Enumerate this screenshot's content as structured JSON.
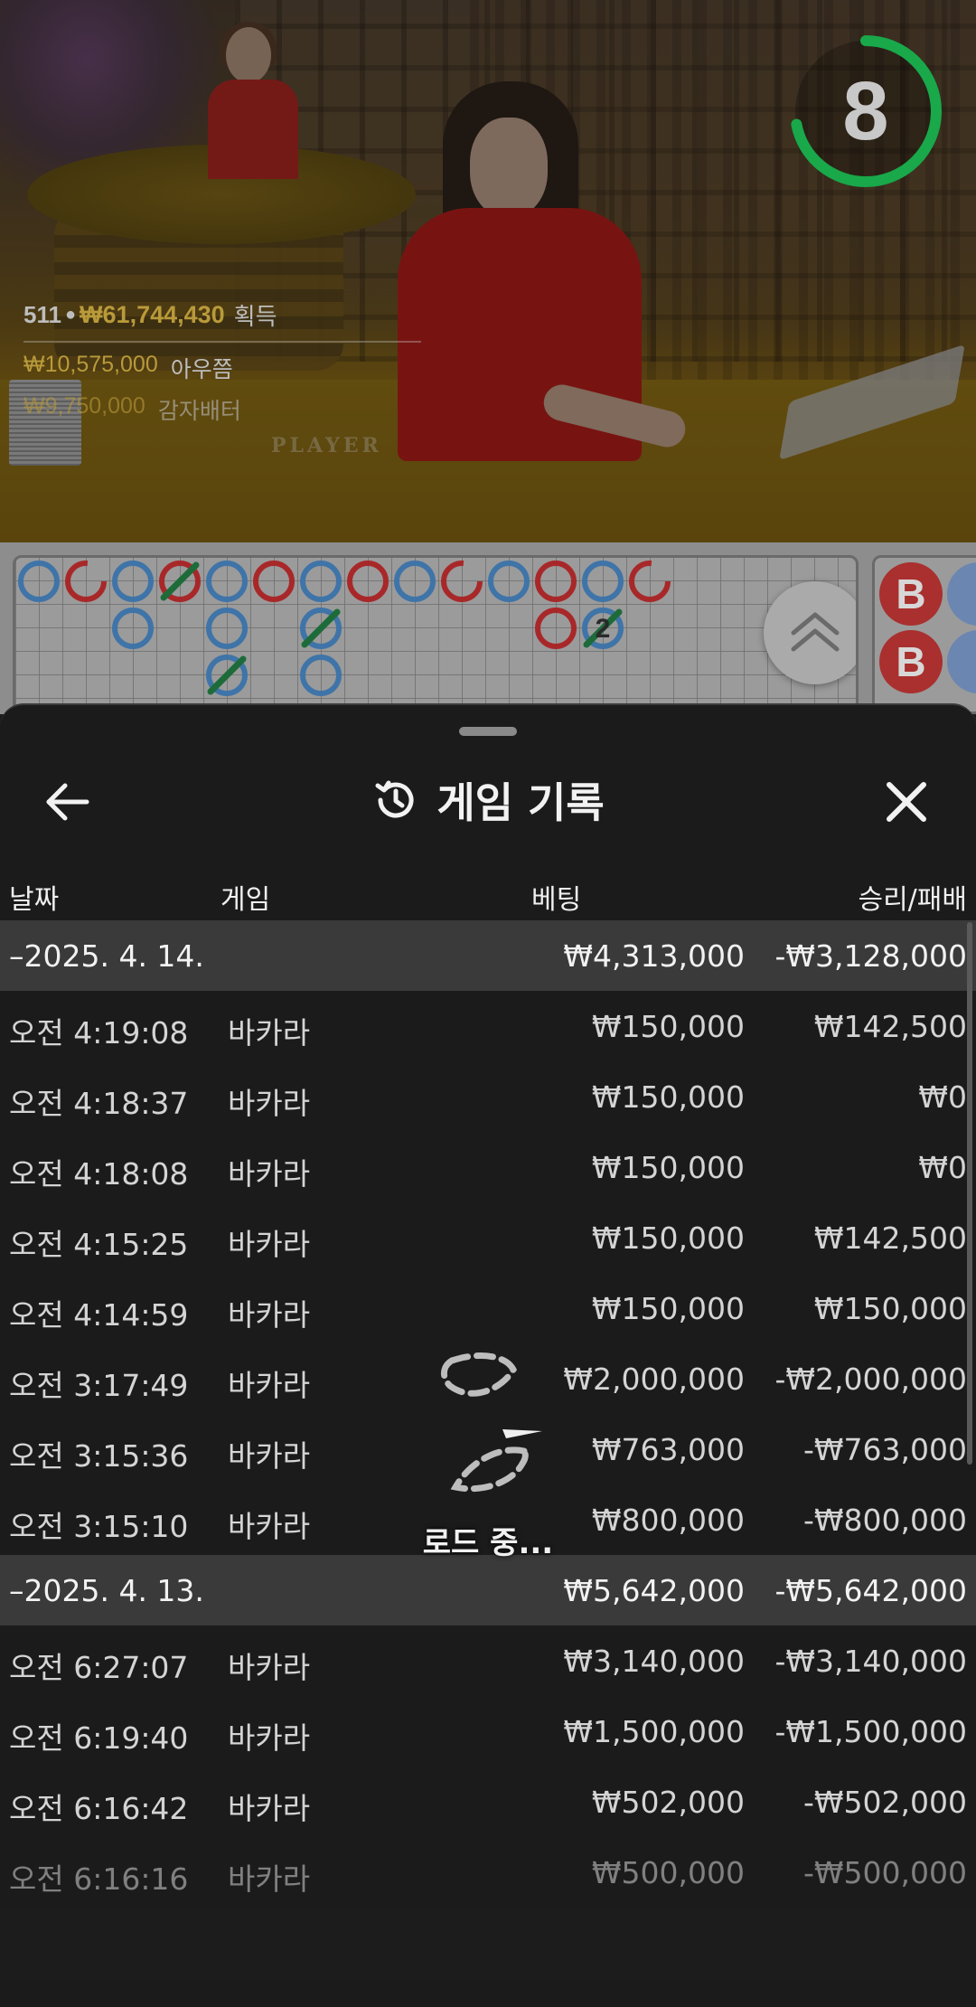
{
  "timer": {
    "value": "8",
    "fraction": 0.72,
    "color": "#19a84a"
  },
  "winners": {
    "count": "511",
    "total": "₩61,744,430",
    "total_label": "획득",
    "top": [
      {
        "amount": "₩10,575,000",
        "name": "아우쯤"
      },
      {
        "amount": "₩9,750,000",
        "name": "감자배터"
      }
    ]
  },
  "table_label": "PLAYER",
  "bigroad_marker": "2",
  "beadroad": [
    "B",
    "B"
  ],
  "sheet": {
    "title": "게임 기록",
    "icons": {
      "back": "arrow-left-icon",
      "history": "history-icon",
      "close": "close-icon"
    },
    "columns": {
      "date": "날짜",
      "game": "게임",
      "bet": "베팅",
      "result": "승리/패배"
    },
    "groups": [
      {
        "date": "–2025. 4. 14.",
        "bet": "₩4,313,000",
        "result": "-₩3,128,000",
        "rows": [
          {
            "time": "오전 4:19:08",
            "game": "바카라",
            "bet": "₩150,000",
            "result": "₩142,500"
          },
          {
            "time": "오전 4:18:37",
            "game": "바카라",
            "bet": "₩150,000",
            "result": "₩0"
          },
          {
            "time": "오전 4:18:08",
            "game": "바카라",
            "bet": "₩150,000",
            "result": "₩0"
          },
          {
            "time": "오전 4:15:25",
            "game": "바카라",
            "bet": "₩150,000",
            "result": "₩142,500"
          },
          {
            "time": "오전 4:14:59",
            "game": "바카라",
            "bet": "₩150,000",
            "result": "₩150,000"
          },
          {
            "time": "오전 3:17:49",
            "game": "바카라",
            "bet": "₩2,000,000",
            "result": "-₩2,000,000"
          },
          {
            "time": "오전 3:15:36",
            "game": "바카라",
            "bet": "₩763,000",
            "result": "-₩763,000"
          },
          {
            "time": "오전 3:15:10",
            "game": "바카라",
            "bet": "₩800,000",
            "result": "-₩800,000"
          }
        ]
      },
      {
        "date": "–2025. 4. 13.",
        "bet": "₩5,642,000",
        "result": "-₩5,642,000",
        "rows": [
          {
            "time": "오전 6:27:07",
            "game": "바카라",
            "bet": "₩3,140,000",
            "result": "-₩3,140,000"
          },
          {
            "time": "오전 6:19:40",
            "game": "바카라",
            "bet": "₩1,500,000",
            "result": "-₩1,500,000"
          },
          {
            "time": "오전 6:16:42",
            "game": "바카라",
            "bet": "₩502,000",
            "result": "-₩502,000"
          },
          {
            "time": "오전 6:16:16",
            "game": "바카라",
            "bet": "₩500,000",
            "result": "-₩500,000"
          }
        ]
      }
    ],
    "loading_text": "로드 중..."
  }
}
